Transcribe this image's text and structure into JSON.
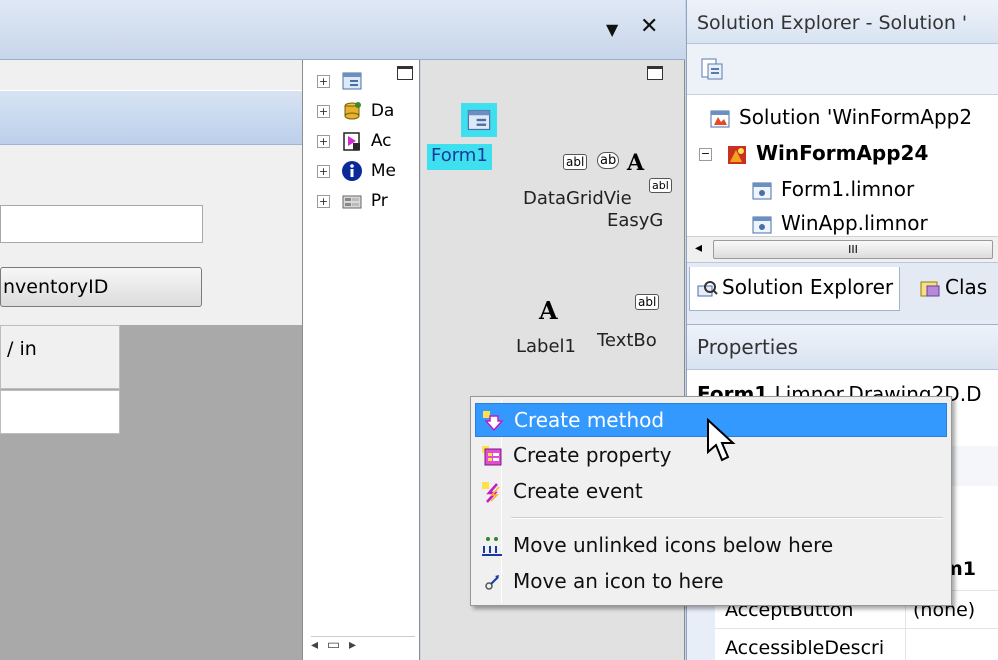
{
  "document_window": {
    "dropdown_glyph": "▼",
    "close_glyph": "✕"
  },
  "form_designer": {
    "button_label": "nventoryID",
    "grid_header_text": "/ in"
  },
  "component_tree": {
    "items": [
      {
        "label": "Da",
        "icon": "database-icon"
      },
      {
        "label": "Ac",
        "icon": "action-icon"
      },
      {
        "label": "Me",
        "icon": "info-icon"
      },
      {
        "label": "Pr",
        "icon": "properties-icon"
      }
    ]
  },
  "canvas": {
    "form_label": "Form1",
    "datagrid_label": "DataGridVie",
    "easygrid_label": "EasyG",
    "label1_label": "Label1",
    "textbox_label": "TextBo",
    "abl_text": "abl",
    "ab_text": "ab",
    "a_glyph": "A"
  },
  "solution_explorer": {
    "title": "Solution Explorer - Solution '",
    "tree": [
      {
        "label": "Solution 'WinFormApp2",
        "icon": "solution-icon",
        "bold": false
      },
      {
        "label": "WinFormApp24",
        "icon": "project-icon",
        "bold": true
      },
      {
        "label": "Form1.limnor",
        "icon": "form-file-icon",
        "bold": false
      },
      {
        "label": "WinApp.limnor",
        "icon": "form-file-icon",
        "bold": false
      }
    ],
    "scroll_glyph": "III",
    "tabs": [
      {
        "label": "Solution Explorer"
      },
      {
        "label": "Clas"
      }
    ]
  },
  "properties": {
    "title": "Properties",
    "object_label": "Form1",
    "object_type": "Limnor.Drawing2D.D",
    "category_fragment": "m1",
    "rows": [
      {
        "name": "AcceptButton",
        "value": "(none)"
      },
      {
        "name": "AccessibleDescri",
        "value": ""
      }
    ]
  },
  "context_menu": {
    "items": [
      {
        "label": "Create method",
        "icon": "create-method-icon",
        "highlighted": true
      },
      {
        "label": "Create property",
        "icon": "create-property-icon",
        "highlighted": false
      },
      {
        "label": "Create event",
        "icon": "create-event-icon",
        "highlighted": false
      },
      {
        "label": "Move unlinked icons below here",
        "icon": "move-unlinked-icon",
        "highlighted": false
      },
      {
        "label": "Move an icon to here",
        "icon": "move-icon-icon",
        "highlighted": false
      }
    ]
  },
  "colors": {
    "menu_highlight": "#3399ff",
    "form_selection": "#3ee0f0"
  }
}
